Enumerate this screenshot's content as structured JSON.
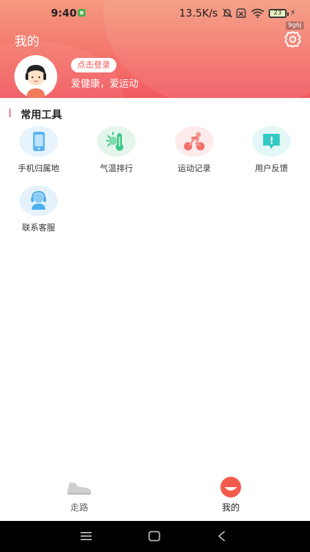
{
  "status_bar": {
    "time": "9:40",
    "network_speed": "13.5K/s",
    "battery_level": "23"
  },
  "header": {
    "title": "我的",
    "version_tag": "9g6j",
    "login_button": "点击登录",
    "slogan": "爱健康，爱运动"
  },
  "tools_section": {
    "title": "常用工具",
    "items": [
      {
        "label": "手机归属地",
        "icon": "phone-icon",
        "color": "#58b6f5"
      },
      {
        "label": "气温排行",
        "icon": "thermometer-icon",
        "color": "#3cc787"
      },
      {
        "label": "运动记录",
        "icon": "cycling-icon",
        "color": "#f0706a"
      },
      {
        "label": "用户反馈",
        "icon": "feedback-icon",
        "color": "#33c9c4"
      },
      {
        "label": "联系客服",
        "icon": "customer-service-icon",
        "color": "#4fb0ee"
      }
    ]
  },
  "tab_bar": {
    "tabs": [
      {
        "label": "走路",
        "icon": "shoe-icon",
        "active": false
      },
      {
        "label": "我的",
        "icon": "profile-face-icon",
        "active": true
      }
    ]
  },
  "colors": {
    "header_start": "#f59a7f",
    "header_end": "#f15a60",
    "accent": "#f15a56"
  }
}
